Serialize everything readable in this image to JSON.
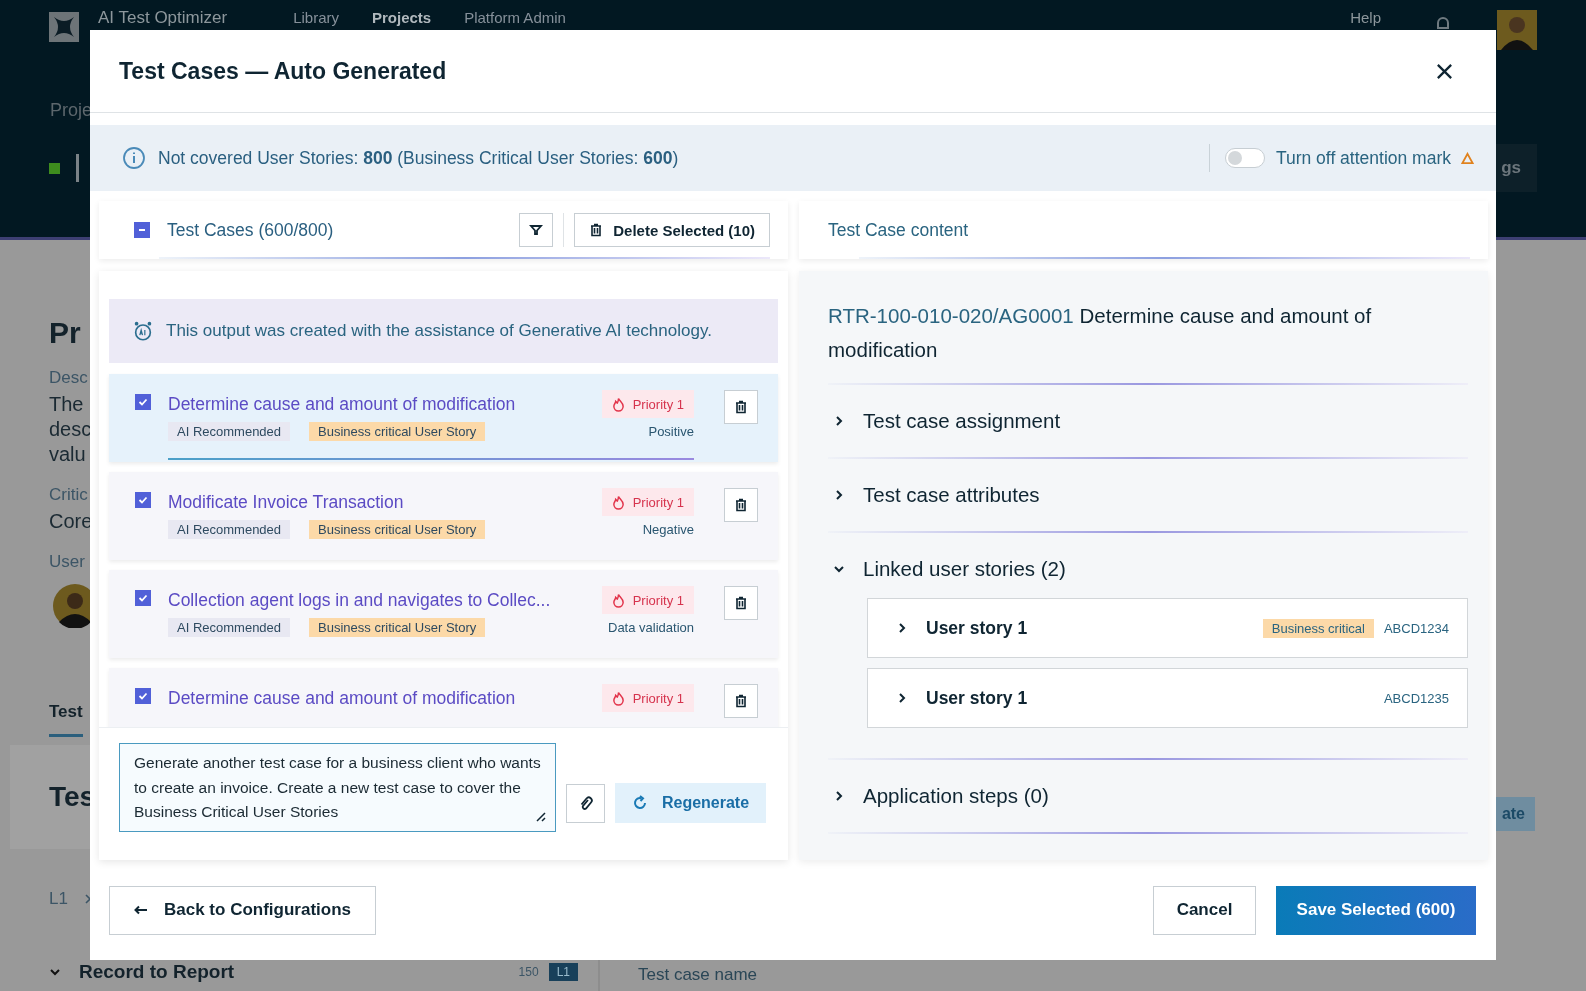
{
  "background": {
    "app_name": "AI Test Optimizer",
    "nav": [
      {
        "label": "Library",
        "selected": false
      },
      {
        "label": "Projects",
        "selected": true
      },
      {
        "label": "Platform Admin",
        "selected": false
      }
    ],
    "help": "Help",
    "breadcrumb": "Proje",
    "settings_button": "gs",
    "project_title": "Pr",
    "fields": [
      {
        "label": "Desc",
        "lines": [
          "The",
          "desc",
          "valu"
        ]
      },
      {
        "label": "Critic",
        "lines": [
          "Core"
        ]
      }
    ],
    "users_label": "User",
    "tab": "Test",
    "section_title": "Tes",
    "path_level": "L1",
    "tree_row": {
      "label": "Record to Report",
      "count": "150",
      "badge": "L1"
    },
    "generate_button": "ate",
    "column_label": "Test case name"
  },
  "dialog": {
    "title": "Test Cases — Auto Generated",
    "notice": {
      "text": "Not covered User Stories: **800** (Business Critical User Stories: **600**)",
      "toggle_label": "Turn off attention mark",
      "toggle_on": false
    },
    "list_header": {
      "label": "Test Cases (600/800)",
      "indeterminate": true,
      "delete_button": "Delete Selected (10)"
    },
    "ai_notice": "This output was created with the assistance of Generative AI technology.",
    "test_cases": [
      {
        "title": "Determine cause and amount of modification",
        "checked": true,
        "selected": true,
        "priority": "Priority 1",
        "tags": [
          "AI Recommended",
          "Business critical User Story"
        ],
        "type": "Positive"
      },
      {
        "title": "Modificate Invoice Transaction",
        "checked": true,
        "selected": false,
        "priority": "Priority 1",
        "tags": [
          "AI Recommended",
          "Business critical User Story"
        ],
        "type": "Negative"
      },
      {
        "title": "Collection agent logs in and navigates to Collec...",
        "checked": true,
        "selected": false,
        "priority": "Priority 1",
        "tags": [
          "AI Recommended",
          "Business critical User Story"
        ],
        "type": "Data validation"
      },
      {
        "title": "Determine cause and amount of modification",
        "checked": true,
        "selected": false,
        "priority": "Priority 1"
      }
    ],
    "prompt": {
      "value": "Generate another test case for a business client who wants to create an invoice. Create a new test case to cover the Business Critical User Stories",
      "regenerate_button": "Regenerate"
    },
    "content_header": "Test Case content",
    "detail": {
      "id": "RTR-100-010-020/AG0001",
      "title": "Determine cause and amount of modification",
      "sections": [
        {
          "label": "Test case assignment",
          "expanded": false
        },
        {
          "label": "Test case attributes",
          "expanded": false
        },
        {
          "label": "Linked user stories (2)",
          "expanded": true,
          "children": [
            {
              "label": "User story 1",
              "expanded": false,
              "tag": "Business critical",
              "code": "ABCD1234"
            },
            {
              "label": "User story 1",
              "expanded": false,
              "code": "ABCD1235"
            }
          ]
        },
        {
          "label": "Application steps (0)",
          "expanded": false
        }
      ]
    },
    "footer": {
      "back_button": "Back to Configurations",
      "cancel_button": "Cancel",
      "save_button": "Save Selected (600)"
    }
  }
}
